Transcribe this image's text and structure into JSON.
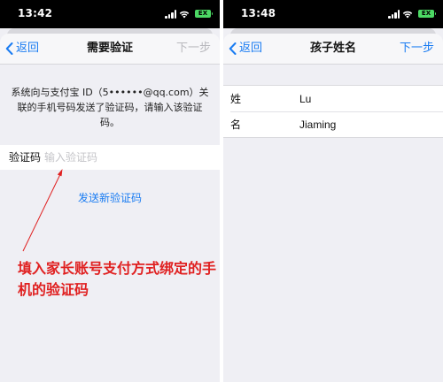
{
  "left": {
    "status": {
      "time": "13:42",
      "battery": "EX"
    },
    "nav": {
      "back": "返回",
      "title": "需要验证",
      "next": "下一步"
    },
    "info": "系统向与支付宝 ID（5••••••@qq.com）关联的手机号码发送了验证码，请输入该验证码。",
    "code": {
      "label": "验证码",
      "placeholder": "输入验证码",
      "value": ""
    },
    "resend": "发送新验证码",
    "annotation": "填入家长账号支付方式绑定的手机的验证码"
  },
  "right": {
    "status": {
      "time": "13:48",
      "battery": "EX"
    },
    "nav": {
      "back": "返回",
      "title": "孩子姓名",
      "next": "下一步"
    },
    "fields": [
      {
        "label": "姓",
        "value": "Lu"
      },
      {
        "label": "名",
        "value": "Jiaming"
      }
    ]
  },
  "colors": {
    "accent": "#1a7cf2",
    "annotation": "#e02020",
    "battery": "#4cd964"
  },
  "icons": [
    "signal-icon",
    "wifi-icon",
    "battery-icon",
    "chevron-left-icon"
  ]
}
